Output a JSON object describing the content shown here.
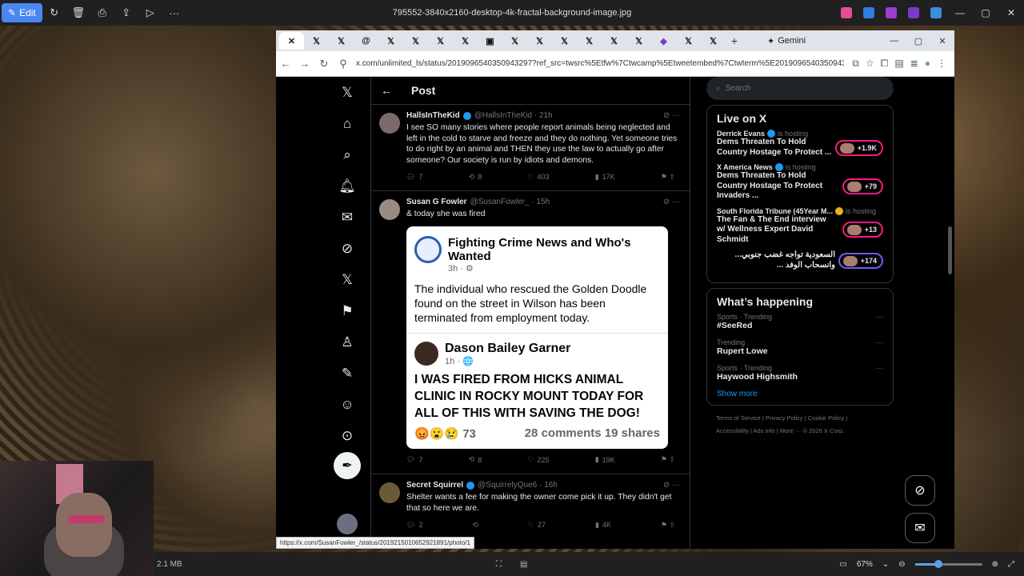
{
  "viewer": {
    "edit_label": "Edit",
    "title": "795552-3840x2160-desktop-4k-fractal-background-image.jpg",
    "file_size": "2.1 MB",
    "zoom": "67%"
  },
  "browser": {
    "gemini_label": "Gemini",
    "url": "x.com/unlimited_ls/status/2019096540350943297?ref_src=twsrc%5Etfw%7Ctwcamp%5Etweetembed%7Ctwterm%5E2019096540350943...",
    "status_url": "https://x.com/SusanFowler_/status/2019215010652921891/photo/1"
  },
  "page": {
    "header": "Post"
  },
  "tweets": [
    {
      "name": "HallsInTheKid",
      "handle": "@HallsInTheKid · 21h",
      "text": "I see SO many stories where people report animals being neglected and left in the cold to starve and freeze and they do nothing. Yet someone tries to do right by an animal and THEN they use the law to actually go after someone? Our society is run by idiots and demons.",
      "replies": "7",
      "reposts": "8",
      "likes": "403",
      "views": "17K"
    },
    {
      "name": "Susan G Fowler",
      "handle": "@SusanFowler_ · 15h",
      "text": "& today she was fired",
      "replies": "7",
      "reposts": "8",
      "likes": "225",
      "views": "19K",
      "embed": {
        "page_name": "Fighting Crime News and Who's Wanted",
        "page_meta": "3h · ⚙",
        "page_text": "The individual who rescued the Golden Doodle found on the street in Wilson has been terminated from employment today.",
        "person": "Dason Bailey Garner",
        "person_meta": "1h · 🌐",
        "shout": "I WAS FIRED FROM HICKS ANIMAL CLINIC IN ROCKY MOUNT TODAY FOR ALL OF THIS WITH SAVING THE DOG!",
        "reactions": "73",
        "comments": "28 comments",
        "shares": "19 shares"
      }
    },
    {
      "name": "Secret Squirrel",
      "handle": "@SquirrelyQue6 · 16h",
      "text": "Shelter wants a fee for making the owner come pick it up. They didn't get that so here we are.",
      "replies": "2",
      "reposts": "",
      "likes": "27",
      "views": "4K"
    }
  ],
  "sidebar": {
    "search_placeholder": "Search",
    "live_title": "Live on X",
    "live": [
      {
        "host": "Derrick Evans",
        "is_hosting": "is hosting",
        "title": "Dems Threaten To Hold Country Hostage To Protect ...",
        "count": "+1.9K"
      },
      {
        "host": "X America News",
        "is_hosting": "is hosting",
        "title": "Dems Threaten To Hold Country Hostage To Protect Invaders ...",
        "count": "+79"
      },
      {
        "host": "South Florida Tribune (45Year M...",
        "is_hosting": "is hosting",
        "title": "The Fan & The End interview w/ Wellness Expert David Schmidt",
        "count": "+13"
      },
      {
        "host": "",
        "is_hosting": "",
        "title": "السعودية تواجه غضب جنوبي... وانسحاب الوفد ...",
        "count": "+174"
      }
    ],
    "happening_title": "What’s happening",
    "trends": [
      {
        "category": "Sports · Trending",
        "name": "#SeeRed"
      },
      {
        "category": "Trending",
        "name": "Rupert Lowe"
      },
      {
        "category": "Sports · Trending",
        "name": "Haywood Highsmith"
      }
    ],
    "show_more": "Show more",
    "footer_line1": "Terms of Service  |  Privacy Policy  |  Cookie Policy  |",
    "footer_line2": "Accessibility  |  Ads info  |  More ···  © 2026 X Corp."
  },
  "colors": {
    "accent": "#1d9bf0",
    "live": "#f91880",
    "edit": "#4a86f0"
  }
}
